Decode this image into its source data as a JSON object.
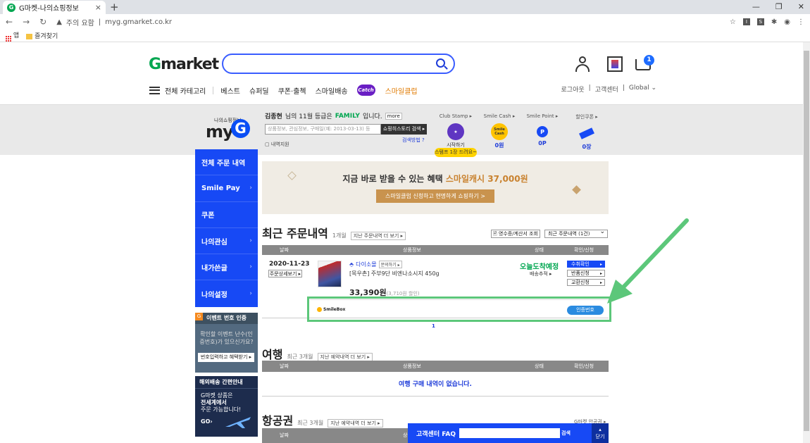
{
  "browser": {
    "tab_title": "G마켓-나의쇼핑정보",
    "tab_favicon": "G",
    "new_tab": "+",
    "security_label": "주의 요함",
    "url": "myg.gmarket.co.kr",
    "bookmarks": [
      {
        "label": "앱"
      },
      {
        "label": "즐겨찾기"
      }
    ],
    "ext_labels": [
      "I",
      "S"
    ]
  },
  "header": {
    "logo_g": "G",
    "logo_rest": "market",
    "search_placeholder": "",
    "cart_count": "1"
  },
  "gnb": {
    "all_categories": "전체 카테고리",
    "items": [
      "베스트",
      "슈퍼딜",
      "쿠폰·출첵",
      "스마일배송"
    ],
    "catch_label": "Catch",
    "smile_club": "스마일클럽",
    "right_links": [
      "로그아웃",
      "고객센터",
      "Global ⌄"
    ]
  },
  "myg": {
    "logo_sub": "나의쇼핑정보",
    "logo_my": "my",
    "logo_g": "G",
    "grade_name": "김종현",
    "grade_text": "님의 11월 등급은",
    "grade_level": "FAMILY",
    "grade_end": "입니다.",
    "more_label": "more",
    "search_placeholder": "상품정보, 관심정보, 구매일(예: 2013-03-13) 등",
    "search_button": "쇼핑히스토리 검색 ▸",
    "search_help": "검색방법 ?",
    "my_help": "내역지원",
    "stats": [
      {
        "label": "Club Stamp ▸",
        "icon": "start",
        "value": "시작하기"
      },
      {
        "label": "Smile Cash ▸",
        "icon": "Smile Cash",
        "value": "0원"
      },
      {
        "label": "Smile Point ▸",
        "icon": "P",
        "value": "0P"
      },
      {
        "label": "할인쿠폰 ▸",
        "icon": "coupon",
        "value": "0장"
      }
    ],
    "stamp_tip": "스탬프 1장 드려요~"
  },
  "side_nav": [
    {
      "label": "전체 주문 내역",
      "arrow": ""
    },
    {
      "label": "Smile Pay",
      "arrow": "›"
    },
    {
      "label": "쿠폰",
      "arrow": ""
    },
    {
      "label": "나의관심",
      "arrow": "›"
    },
    {
      "label": "내가쓴글",
      "arrow": "›"
    },
    {
      "label": "나의설정",
      "arrow": "›"
    }
  ],
  "event_box": {
    "badge": "G",
    "title": "이벤트 번호 인증",
    "text": "확인할 이벤트 난수(인증번호)가 있으신가요?",
    "button": "번호입력하고 혜택받기 ▸"
  },
  "overseas_box": {
    "title": "해외배송 간편안내",
    "line1": "G마켓 상품은",
    "line2": "전세계에서",
    "line3": "주문 가능합니다!",
    "go": "GO›"
  },
  "banner": {
    "text": "지금 바로 받을 수 있는 혜택",
    "highlight": "스마일캐시 37,000원",
    "button": "스마일클럽 신청하고 현명하게 쇼핑하기 >"
  },
  "recent_orders": {
    "title": "최근 주문내역",
    "period": "1개월",
    "more_button": "지난 주문내역 더 보기 ▸",
    "receipt_button": "영수증/계산서 조회",
    "period_select": "최근 주문내역 (1건)",
    "columns": [
      "날짜",
      "상품정보",
      "상태",
      "확인/신청"
    ],
    "order": {
      "date": "2020-11-23",
      "detail_button": "주문상세보기 ▸",
      "seller": "다이소몰",
      "seller_button": "문의하기 ▸",
      "product_name": "[목우촌] 주부9단 비엔나소시지 450g",
      "price": "33,390원",
      "discount": "(3,710원 할인)",
      "status": "오늘도착예정",
      "track_button": "배송추적 ▸",
      "actions": [
        "수취확인",
        "반품신청",
        "교환신청"
      ]
    },
    "smilebox_label": "SmileBox",
    "auth_button": "인증번호",
    "page": "1"
  },
  "travel": {
    "title": "여행",
    "period": "최근 3개월",
    "more_button": "지난 예약내역 더 보기 ▸",
    "columns": [
      "날짜",
      "상품정보",
      "상태",
      "확인/신청"
    ],
    "empty": "여행 구매 내역이 없습니다."
  },
  "airline": {
    "title": "항공권",
    "period": "최근 3개월",
    "more_button": "지난 예약내역 더 보기 ▸",
    "notice": "G마켓 안공권 ▸",
    "columns": [
      "날짜",
      "상품정보"
    ]
  },
  "faq": {
    "label": "고객센터 FAQ",
    "search_button": "검색",
    "close_label": "닫기"
  }
}
